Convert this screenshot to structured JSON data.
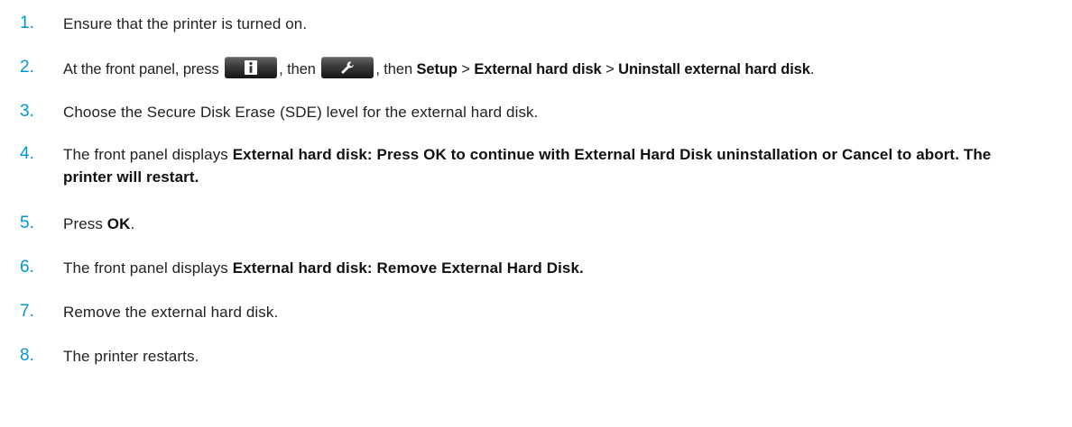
{
  "steps": [
    {
      "number": "1.",
      "text": "Ensure that the printer is turned on."
    },
    {
      "number": "2.",
      "part1": "At the front panel, press",
      "icon1": "info-icon",
      "part2": ", then",
      "icon2": "wrench-icon",
      "part3": ", then",
      "setup": "Setup",
      "sep1": ">",
      "external_hard_disk": "External hard disk",
      "sep2": ">",
      "uninstall": "Uninstall external hard disk",
      "period": "."
    },
    {
      "number": "3.",
      "text": "Choose the Secure Disk Erase (SDE) level for the external hard disk."
    },
    {
      "number": "4.",
      "intro": "The front panel displays",
      "message": "External hard disk: Press OK to continue with External Hard Disk uninstallation or Cancel to abort. The printer will restart."
    },
    {
      "number": "5.",
      "intro": "Press",
      "ok": "OK",
      "period": "."
    },
    {
      "number": "6.",
      "intro": "The front panel displays",
      "message": "External hard disk: Remove External Hard Disk."
    },
    {
      "number": "7.",
      "text": "Remove the external hard disk."
    },
    {
      "number": "8.",
      "text": "The printer restarts."
    }
  ],
  "colors": {
    "step_number": "#0096d6",
    "body_text": "#222222",
    "panel_button": "#2b2b2b"
  }
}
